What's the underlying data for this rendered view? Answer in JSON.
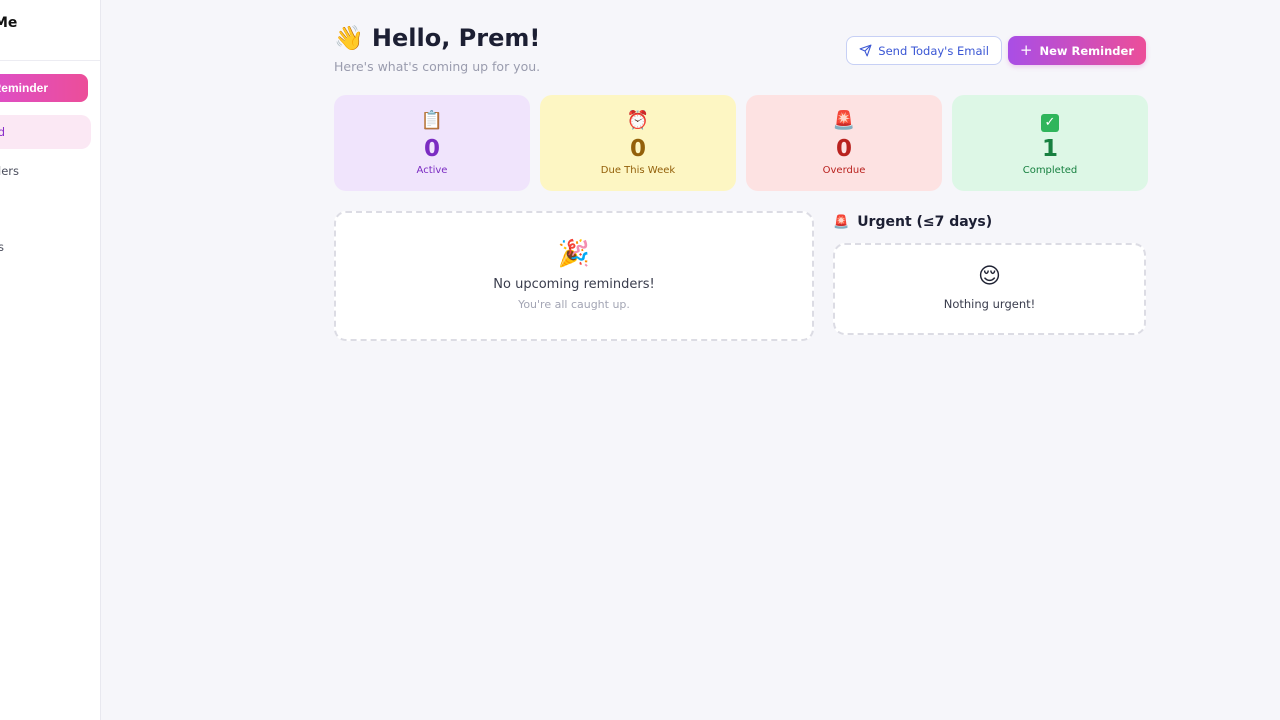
{
  "sidebar": {
    "brand": "Me",
    "new_button_label": "Reminder",
    "items": [
      {
        "label": "d"
      },
      {
        "label": "ders"
      },
      {
        "label": "s"
      }
    ]
  },
  "header": {
    "wave_emoji": "👋",
    "greeting": "Hello, Prem!",
    "subtitle": "Here's what's coming up for you.",
    "send_email_label": "Send Today's Email",
    "new_reminder_label": "New Reminder"
  },
  "stats": [
    {
      "icon": "📋",
      "icon_name": "clipboard-icon",
      "value": "0",
      "label": "Active",
      "color": "#7b2cc2"
    },
    {
      "icon": "⏰",
      "icon_name": "alarm-clock-icon",
      "value": "0",
      "label": "Due This Week",
      "color": "#93600a"
    },
    {
      "icon": "🚨",
      "icon_name": "siren-icon",
      "value": "0",
      "label": "Overdue",
      "color": "#b9221f"
    },
    {
      "icon": "✓",
      "icon_name": "check-box-icon",
      "value": "1",
      "label": "Completed",
      "color": "#178040"
    }
  ],
  "upcoming": {
    "emoji": "🎉",
    "title": "No upcoming reminders!",
    "subtitle": "You're all caught up."
  },
  "urgent": {
    "icon": "🚨",
    "title": "Urgent (≤7 days)",
    "emoji": "😌",
    "empty_text": "Nothing urgent!"
  },
  "colors": {
    "accent_gradient_start": "#a94ee6",
    "accent_gradient_end": "#ec4e99",
    "background": "#f6f6fa"
  }
}
